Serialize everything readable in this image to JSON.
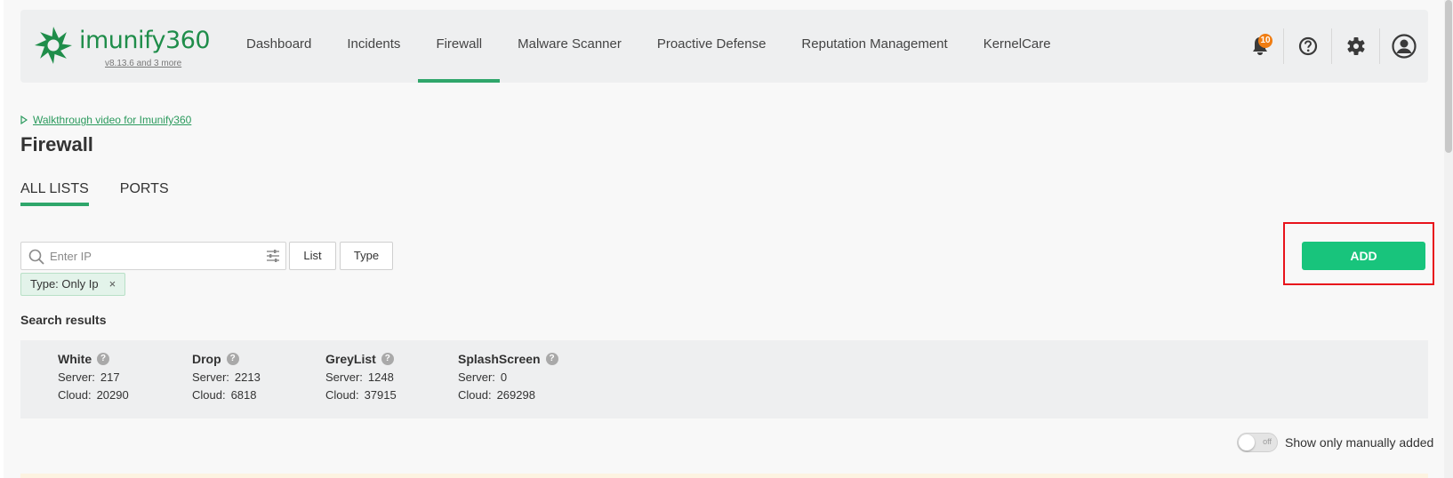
{
  "header": {
    "logo_text": "imunify360",
    "version_text": "v8.13.6 and 3 more",
    "nav": [
      {
        "label": "Dashboard"
      },
      {
        "label": "Incidents"
      },
      {
        "label": "Firewall"
      },
      {
        "label": "Malware Scanner"
      },
      {
        "label": "Proactive Defense"
      },
      {
        "label": "Reputation Management"
      },
      {
        "label": "KernelCare"
      }
    ],
    "active_nav": "Firewall",
    "notification_count": "10",
    "icons": [
      "bell-icon",
      "help-icon",
      "gear-icon",
      "user-icon"
    ]
  },
  "walkthrough": {
    "icon": "play-icon",
    "label": "Walkthrough video for Imunify360"
  },
  "page_title": "Firewall",
  "tabs": [
    {
      "label": "ALL LISTS",
      "active": true
    },
    {
      "label": "PORTS",
      "active": false
    }
  ],
  "search": {
    "placeholder": "Enter IP",
    "value": ""
  },
  "filters": {
    "list_label": "List",
    "type_label": "Type"
  },
  "active_filter_chip": {
    "label": "Type:  Only Ip",
    "close": "×"
  },
  "add_button_label": "ADD",
  "search_results_label": "Search results",
  "stats": [
    {
      "name": "White",
      "server_label": "Server:",
      "server": "217",
      "cloud_label": "Cloud:",
      "cloud": "20290"
    },
    {
      "name": "Drop",
      "server_label": "Server:",
      "server": "2213",
      "cloud_label": "Cloud:",
      "cloud": "6818"
    },
    {
      "name": "GreyList",
      "server_label": "Server:",
      "server": "1248",
      "cloud_label": "Cloud:",
      "cloud": "37915"
    },
    {
      "name": "SplashScreen",
      "server_label": "Server:",
      "server": "0",
      "cloud_label": "Cloud:",
      "cloud": "269298"
    }
  ],
  "toggle": {
    "state_text": "off",
    "label": "Show only manually added"
  },
  "colors": {
    "accent_green": "#2fa66b",
    "add_button": "#18c47c",
    "highlight_red": "#e8131b",
    "badge_orange": "#f07d12"
  }
}
